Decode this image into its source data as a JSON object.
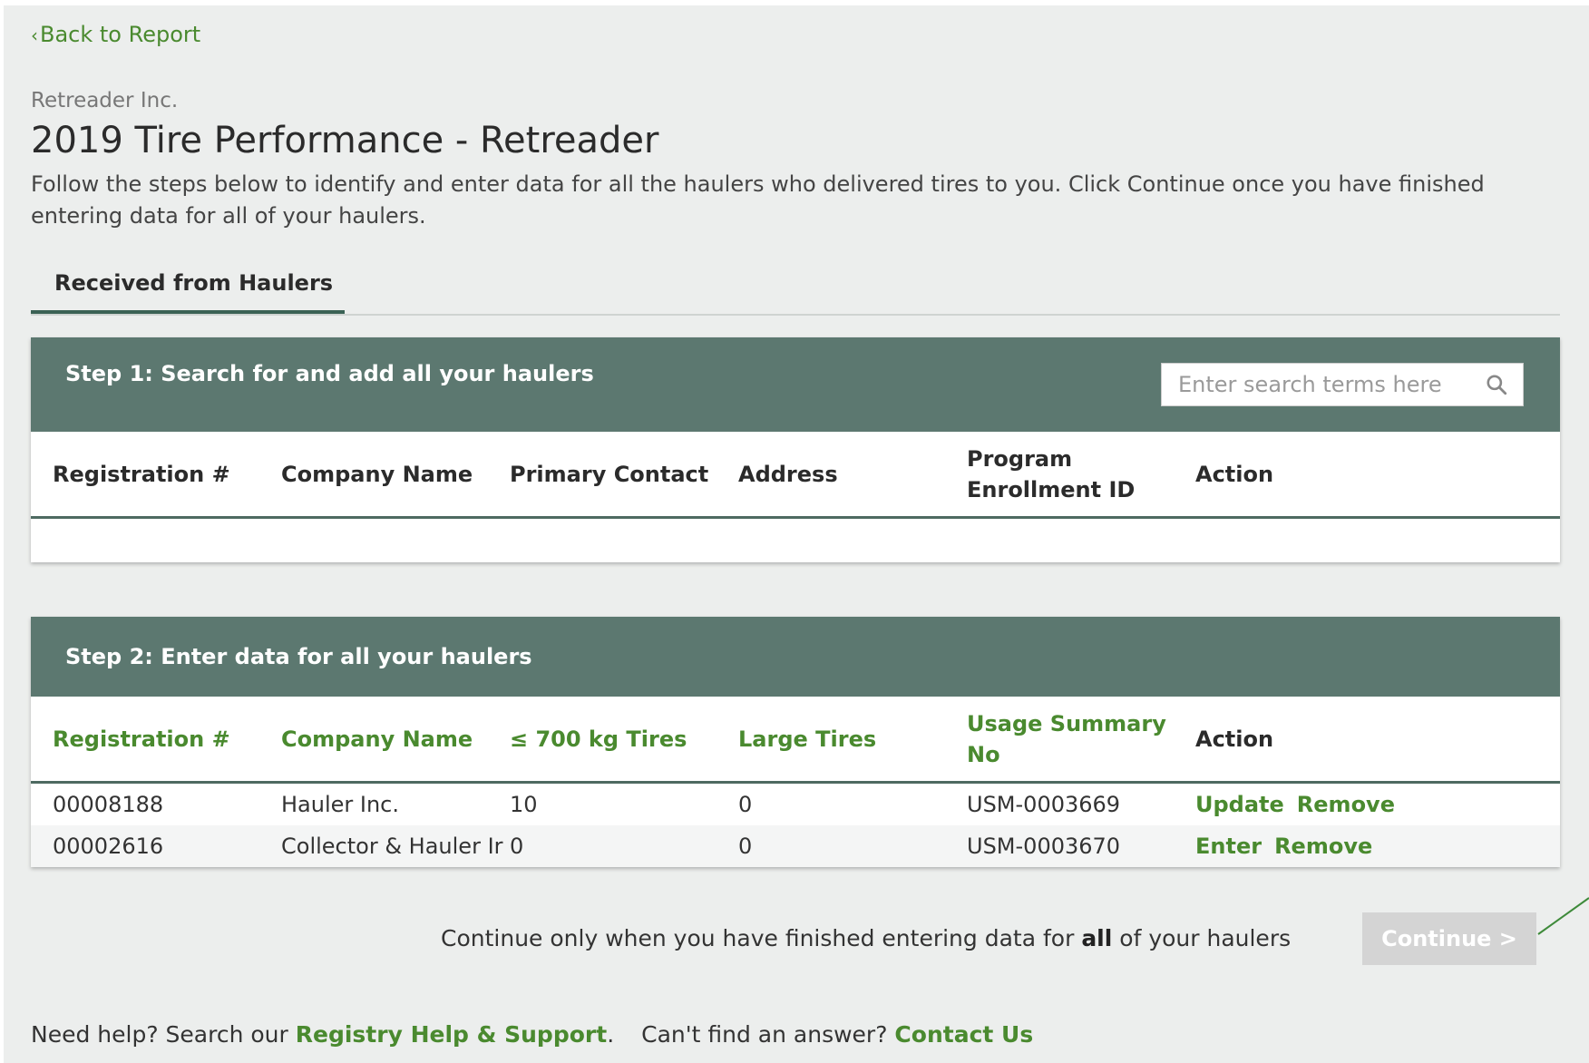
{
  "nav": {
    "back_label": "Back to Report"
  },
  "header": {
    "org_name": "Retreader Inc.",
    "title": "2019 Tire Performance - Retreader",
    "description": "Follow the steps below to identify and enter data for all the haulers who delivered tires to you. Click Continue once you have finished entering data for all of your haulers."
  },
  "tabs": [
    {
      "label": "Received from Haulers",
      "active": true
    }
  ],
  "step1": {
    "title": "Step 1: Search for and add all your haulers",
    "search_placeholder": "Enter search terms here",
    "columns": [
      "Registration #",
      "Company Name",
      "Primary Contact",
      "Address",
      "Program Enrollment ID",
      "Action"
    ],
    "rows": []
  },
  "step2": {
    "title": "Step 2: Enter data for all your haulers",
    "columns": [
      "Registration #",
      "Company Name",
      "≤ 700 kg Tires",
      "Large Tires",
      "Usage Summary No",
      "Action"
    ],
    "rows": [
      {
        "registration": "00008188",
        "company": "Hauler Inc.",
        "small_tires": "10",
        "large_tires": "0",
        "usage_summary": "USM-0003669",
        "actions": [
          "Update",
          "Remove"
        ]
      },
      {
        "registration": "00002616",
        "company": "Collector & Hauler Ir",
        "small_tires": "0",
        "large_tires": "0",
        "usage_summary": "USM-0003670",
        "actions": [
          "Enter",
          "Remove"
        ]
      }
    ]
  },
  "footer": {
    "continue_note_before": "Continue only when you have finished entering data for ",
    "continue_note_bold": "all",
    "continue_note_after": " of your haulers",
    "continue_label": "Continue >",
    "help_prefix": "Need help? Search our ",
    "help_link": "Registry Help & Support",
    "help_suffix": ".",
    "answer_prefix": "Can't find an answer? ",
    "answer_link": "Contact Us"
  },
  "colors": {
    "accent_green": "#4a8a2f",
    "header_band": "#5c7870",
    "page_bg": "#eceeed",
    "disabled_button": "#d4d4d4"
  }
}
